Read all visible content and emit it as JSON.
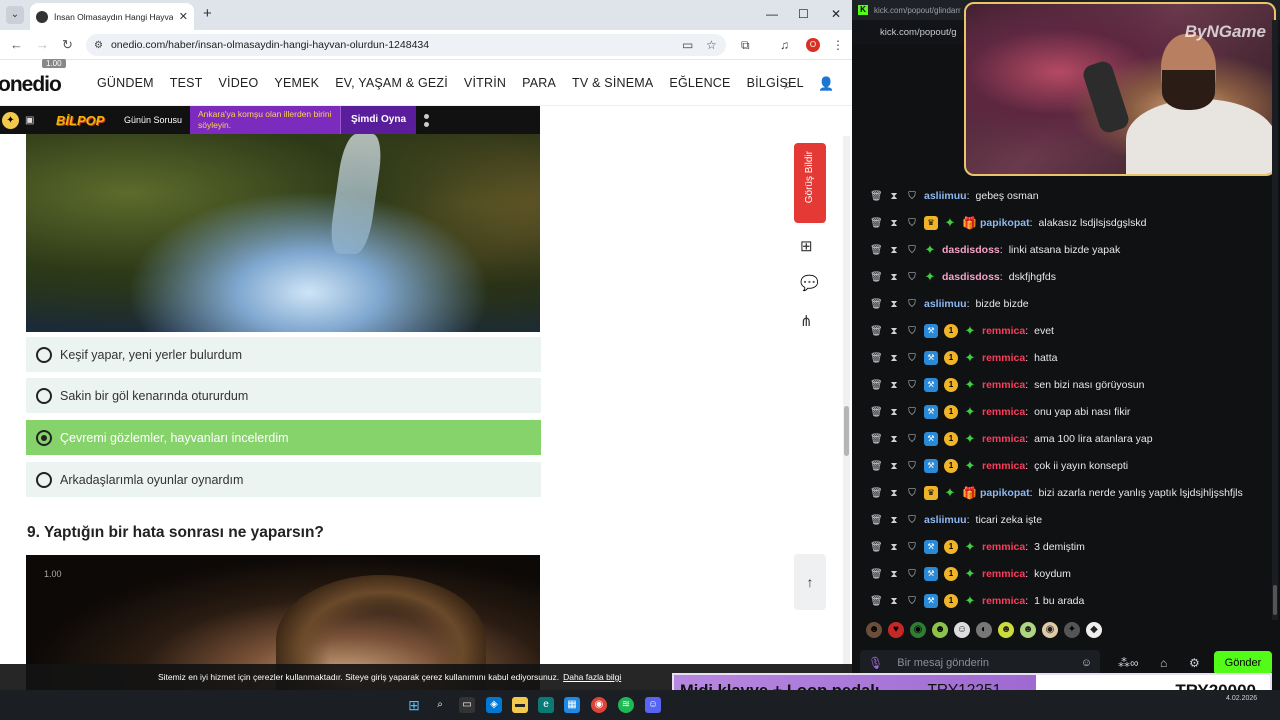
{
  "browser": {
    "tab_title": "İnsan Olmasaydın Hangi Hayvan Ol…",
    "url": "onedio.com/haber/insan-olmasaydin-hangi-hayvan-olurdun-1248434",
    "profile_initial": "O"
  },
  "site": {
    "logo": "onedio",
    "zoom_pill": "1.00",
    "menu": [
      "GÜNDEM",
      "TEST",
      "VİDEO",
      "YEMEK",
      "EV, YAŞAM & GEZİ",
      "VİTRİN",
      "PARA",
      "TV & SİNEMA",
      "EĞLENCE",
      "BİLGİSEL"
    ],
    "promo": {
      "logo": "BİLPOP",
      "label": "Günün Sorusu",
      "question": "Ankara'ya komşu olan illerden birini söyleyin.",
      "cta": "Şimdi Oyna"
    },
    "quiz": {
      "options": [
        {
          "label": "Keşif yapar, yeni yerler bulurdum",
          "selected": false
        },
        {
          "label": "Sakin bir göl kenarında otururdum",
          "selected": false
        },
        {
          "label": "Çevremi gözlemler, hayvanları incelerdim",
          "selected": true
        },
        {
          "label": "Arkadaşlarımla oyunlar oynardım",
          "selected": false
        }
      ],
      "next_question": "9. Yaptığın bir hata sonrası ne yaparsın?",
      "video_zoom": "1.00"
    },
    "side_button": "Görüş Bildir",
    "cookie_text": "Sitemiz en iyi hizmet için çerezler kullanmaktadır. Siteye giriş yaparak çerez kullanımını kabul ediyorsunuz.",
    "cookie_link": "Daha fazla bilgi"
  },
  "chat": {
    "popout_url_top": "kick.com/popout/glindarr",
    "popout_url": "kick.com/popout/g",
    "watermark": "ByNGame",
    "messages": [
      {
        "user": "asliimuu",
        "text": "gebeş osman",
        "color": "#8fb8f0",
        "badges": [
          "shield"
        ]
      },
      {
        "user": "papikopat",
        "text": "alakasız lsdjlsjsdgşlskd",
        "color": "#8fb8f0",
        "badges": [
          "shield",
          "crown",
          "green",
          "gift"
        ]
      },
      {
        "user": "dasdisdoss",
        "text": "linki atsana bizde yapak",
        "color": "#f5a3c7",
        "badges": [
          "shield",
          "green"
        ]
      },
      {
        "user": "dasdisdoss",
        "text": "dskfjhgfds",
        "color": "#f5a3c7",
        "badges": [
          "shield",
          "green"
        ]
      },
      {
        "user": "asliimuu",
        "text": "bizde bizde",
        "color": "#8fb8f0",
        "badges": [
          "shield"
        ]
      },
      {
        "user": "remmica",
        "text": "evet",
        "color": "#ff3b5c",
        "badges": [
          "shield",
          "blue",
          "gold",
          "green"
        ]
      },
      {
        "user": "remmica",
        "text": "hatta",
        "color": "#ff3b5c",
        "badges": [
          "shield",
          "blue",
          "gold",
          "green"
        ]
      },
      {
        "user": "remmica",
        "text": "sen bizi nası görüyosun",
        "color": "#ff3b5c",
        "badges": [
          "shield",
          "blue",
          "gold",
          "green"
        ]
      },
      {
        "user": "remmica",
        "text": "onu yap abi nası fikir",
        "color": "#ff3b5c",
        "badges": [
          "shield",
          "blue",
          "gold",
          "green"
        ]
      },
      {
        "user": "remmica",
        "text": "ama 100 lira atanlara yap",
        "color": "#ff3b5c",
        "badges": [
          "shield",
          "blue",
          "gold",
          "green"
        ]
      },
      {
        "user": "remmica",
        "text": "çok ii yayın konsepti",
        "color": "#ff3b5c",
        "badges": [
          "shield",
          "blue",
          "gold",
          "green"
        ]
      },
      {
        "user": "papikopat",
        "text": "bizi azarla nerde yanlış yaptık lşjdsjhljşshfjls",
        "color": "#8fb8f0",
        "badges": [
          "shield",
          "crown",
          "green",
          "gift"
        ]
      },
      {
        "user": "asliimuu",
        "text": "ticari zeka işte",
        "color": "#8fb8f0",
        "badges": [
          "shield"
        ]
      },
      {
        "user": "remmica",
        "text": "3 demiştim",
        "color": "#ff3b5c",
        "badges": [
          "shield",
          "blue",
          "gold",
          "green"
        ]
      },
      {
        "user": "remmica",
        "text": "koydum",
        "color": "#ff3b5c",
        "badges": [
          "shield",
          "blue",
          "gold",
          "green"
        ]
      },
      {
        "user": "remmica",
        "text": "1 bu arada",
        "color": "#ff3b5c",
        "badges": [
          "shield",
          "blue",
          "gold",
          "green"
        ]
      }
    ],
    "input_placeholder": "Bir mesaj gönderin",
    "send_label": "Gönder"
  },
  "donation": {
    "item": "Midi klavye + Loop pedalı",
    "raised": "TRY12251",
    "goal": "TRY20000"
  },
  "taskbar": {
    "date": "4.02.2026"
  }
}
